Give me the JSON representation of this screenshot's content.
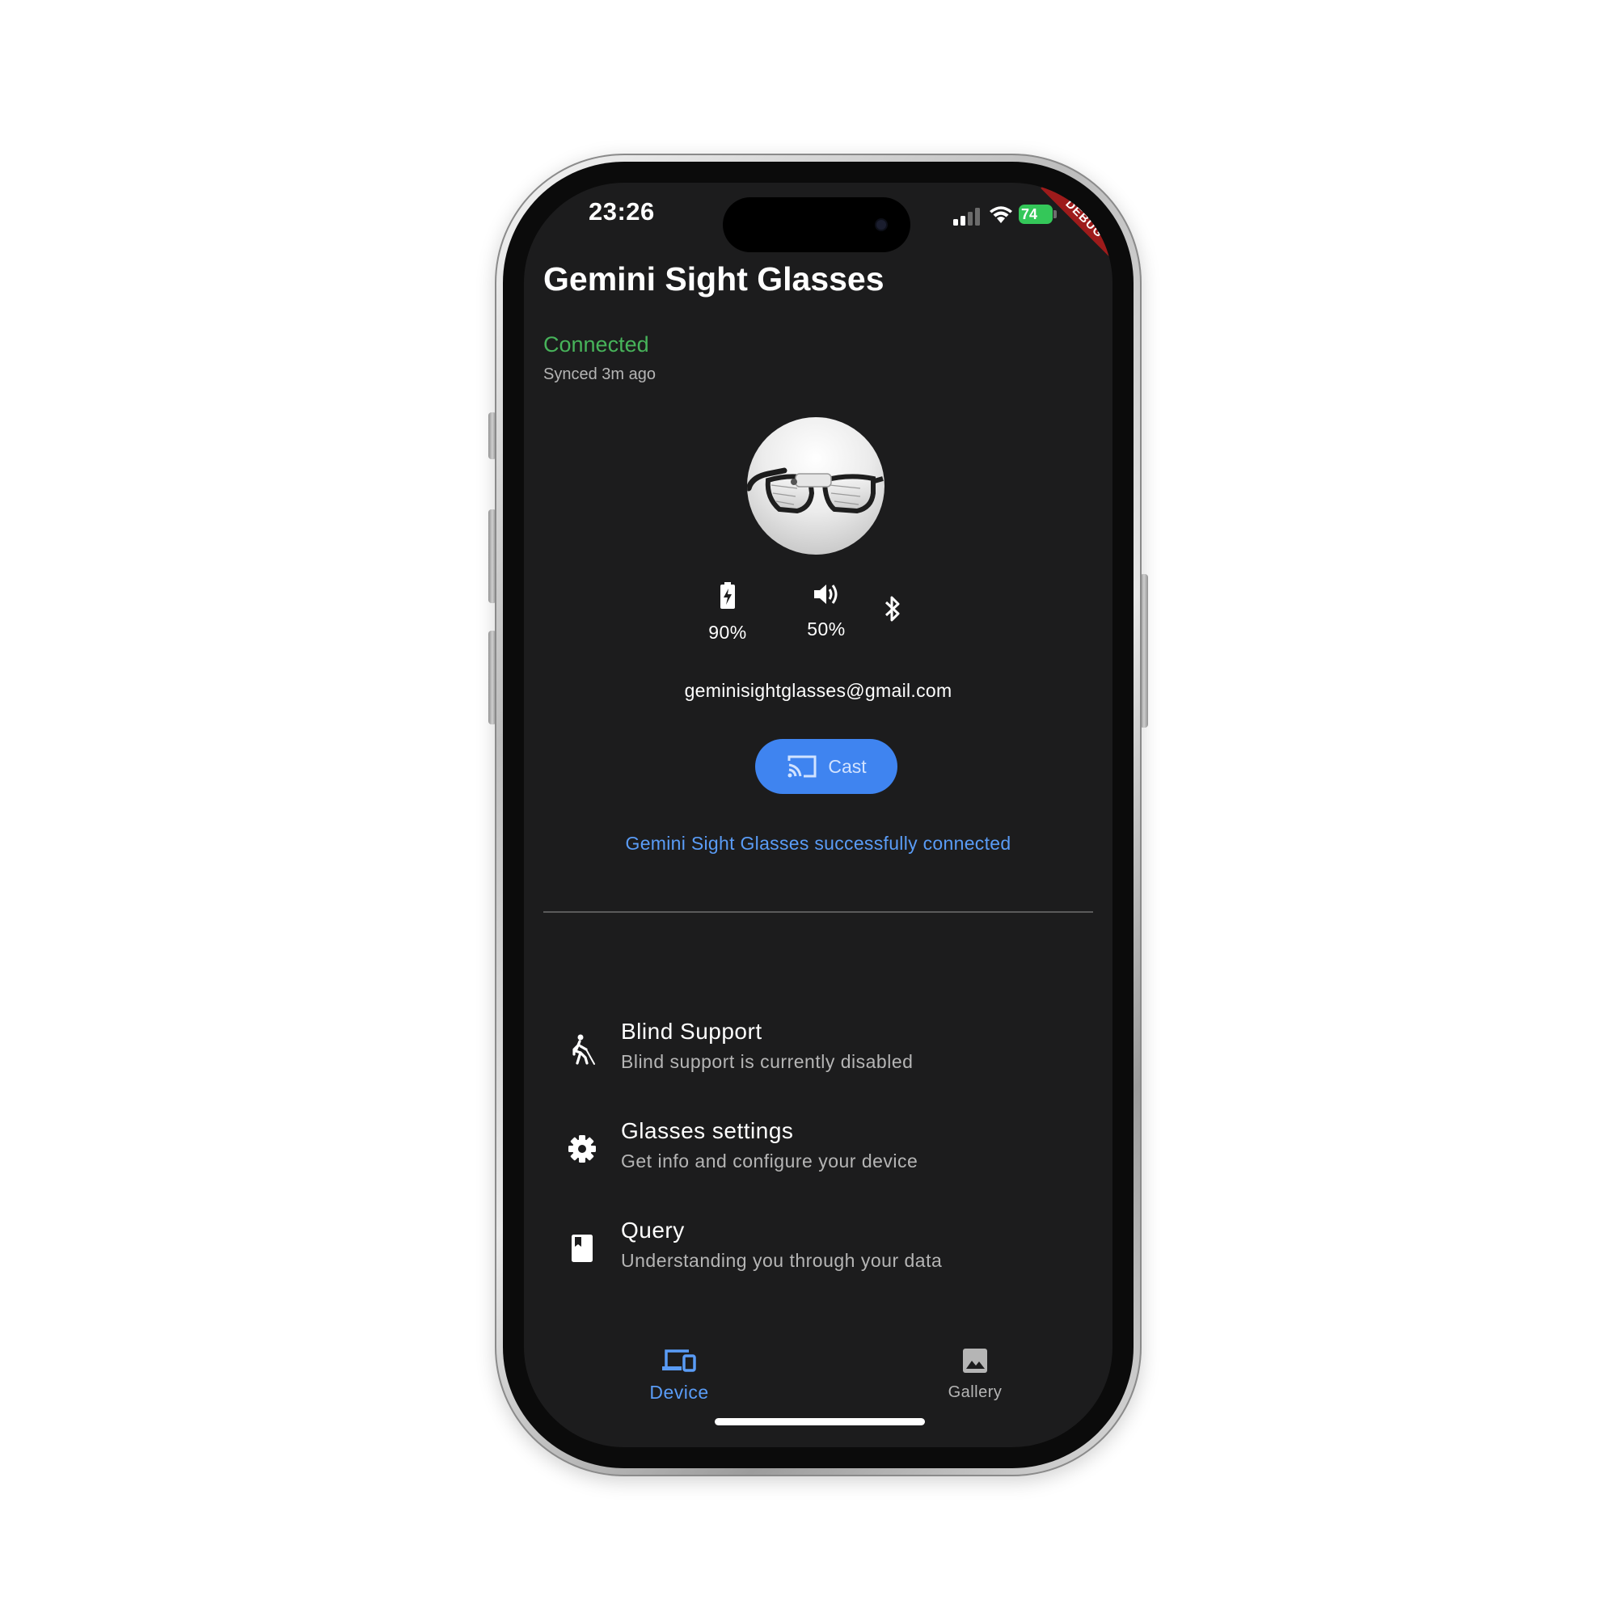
{
  "status_bar": {
    "time": "23:26",
    "battery_level": "74",
    "debug_label": "DEBUG",
    "icons": [
      "cellular-signal-icon",
      "wifi-icon",
      "battery-charging-icon"
    ]
  },
  "header": {
    "title": "Gemini Sight Glasses"
  },
  "connection": {
    "status": "Connected",
    "status_color": "#47b35a",
    "synced": "Synced 3m ago"
  },
  "device_stats": {
    "battery": {
      "icon": "battery-charging-icon",
      "value": "90%"
    },
    "volume": {
      "icon": "volume-up-icon",
      "value": "50%"
    },
    "bluetooth": {
      "icon": "bluetooth-icon"
    }
  },
  "account": {
    "email": "geminisightglasses@gmail.com"
  },
  "cast": {
    "label": "Cast",
    "icon": "cast-icon",
    "color": "#3f84f0"
  },
  "message": {
    "text": "Gemini Sight Glasses successfully connected",
    "color": "#5a9cf6"
  },
  "menu": {
    "items": [
      {
        "icon": "blind-walking-icon",
        "title": "Blind Support",
        "subtitle": "Blind support is currently disabled"
      },
      {
        "icon": "gear-icon",
        "title": "Glasses settings",
        "subtitle": "Get info and configure your device"
      },
      {
        "icon": "bookmark-book-icon",
        "title": "Query",
        "subtitle": "Understanding you through your data"
      }
    ]
  },
  "bottom_nav": {
    "items": [
      {
        "icon": "devices-icon",
        "label": "Device",
        "active": true
      },
      {
        "icon": "image-icon",
        "label": "Gallery",
        "active": false
      }
    ],
    "active_color": "#5a9cf6"
  }
}
